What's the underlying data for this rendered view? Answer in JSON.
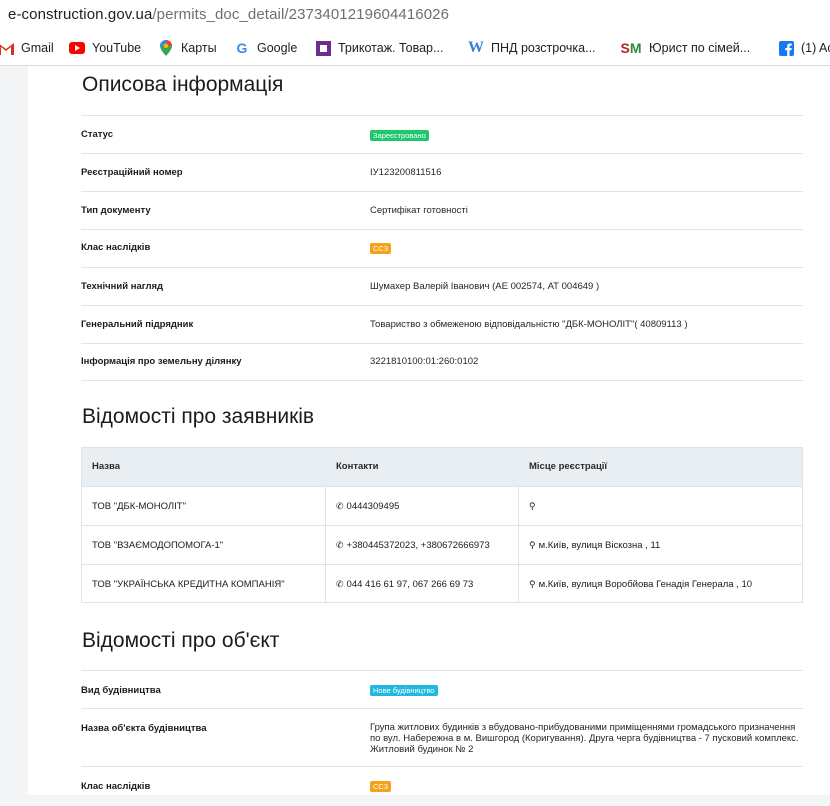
{
  "browser": {
    "url_host": "e-construction.gov.ua",
    "url_path": "/permits_doc_detail/2373401219604416026",
    "bookmarks": [
      "Gmail",
      "YouTube",
      "Карты",
      "Google",
      "Трикотаж. Товар...",
      "ПНД розстрочка...",
      "Юрист по сімей...",
      "(1) Ac"
    ]
  },
  "descriptive": {
    "title": "Описова інформація",
    "rows": [
      {
        "label": "Статус",
        "badge": "Зареєстровано",
        "badge_color": "#1ec86a"
      },
      {
        "label": "Реєстраційний номер",
        "value": "ІУ123200811516"
      },
      {
        "label": "Тип документу",
        "value": "Сертифікат готовності"
      },
      {
        "label": "Клас наслідків",
        "badge": "СС3",
        "badge_color": "#f5a21b"
      },
      {
        "label": "Технічний нагляд",
        "value": "Шумахер Валерій Іванович (АЕ 002574, АТ 004649 )"
      },
      {
        "label": "Генеральний підрядник",
        "value": "Товариство з обмеженою відповідальністю \"ДБК-МОНОЛІТ\"( 40809113 )"
      },
      {
        "label": "Інформація про земельну ділянку",
        "value": "3221810100:01:260:0102"
      }
    ]
  },
  "applicants": {
    "title": "Відомості про заявників",
    "columns": [
      "Назва",
      "Контакти",
      "Місце реєстрації"
    ],
    "rows": [
      {
        "name": "ТОВ \"ДБК-МОНОЛІТ\"",
        "contacts": "0444309495",
        "location": ""
      },
      {
        "name": "ТОВ \"ВЗАЄМОДОПОМОГА-1\"",
        "contacts": "+380445372023, +380672666973",
        "location": "м.Київ, вулиця Віскозна , 11"
      },
      {
        "name": "ТОВ \"УКРАЇНСЬКА КРЕДИТНА КОМПАНІЯ\"",
        "contacts": "044 416 61 97, 067 266 69 73",
        "location": "м.Київ, вулиця Воробйова Генадія Генерала , 10"
      }
    ]
  },
  "object": {
    "title": "Відомості про об'єкт",
    "rows": [
      {
        "label": "Вид будівництва",
        "badge": "Нове будівництво",
        "badge_color": "#1fb9e0"
      },
      {
        "label": "Назва об'єкта будівництва",
        "value": "Група житлових будинків з вбудовано-прибудованими приміщеннями громадського призначення по вул. Набережна в м. Вишгород (Коригування). Друга черга будівництва - 7 пусковий комплекс. Житловий будинок № 2"
      },
      {
        "label": "Клас наслідків",
        "badge": "СС3",
        "badge_color": "#f5a21b"
      }
    ]
  }
}
